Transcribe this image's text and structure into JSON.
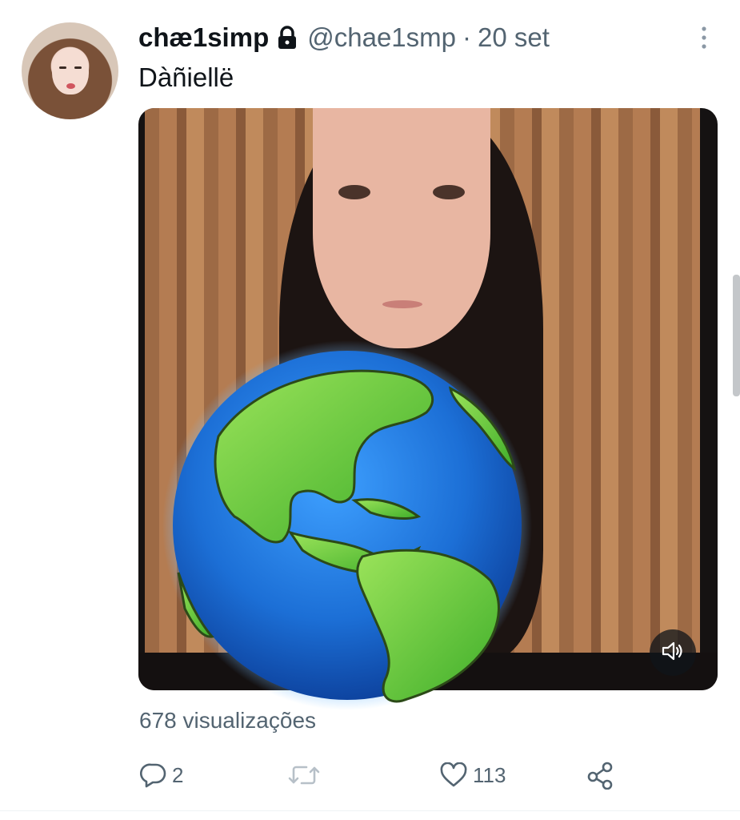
{
  "tweet": {
    "display_name": "chæ1simp",
    "protected_icon": "lock-icon",
    "handle": "@chae1smp",
    "separator": "·",
    "date": "20 set",
    "text": "Dàñiellë",
    "more_icon": "more-vertical-icon",
    "views_text": "678 visualizações",
    "actions": {
      "reply_count": "2",
      "retweet_count": "",
      "like_count": "113",
      "reply_icon": "reply-icon",
      "retweet_icon": "retweet-icon",
      "like_icon": "heart-icon",
      "share_icon": "share-icon"
    },
    "media": {
      "overlay_icon": "globe-icon",
      "volume_icon": "volume-icon"
    }
  },
  "colors": {
    "text_primary": "#0f1419",
    "text_secondary": "#536471",
    "globe_ocean": "#1e6fd9",
    "globe_land": "#6ccf3a"
  }
}
